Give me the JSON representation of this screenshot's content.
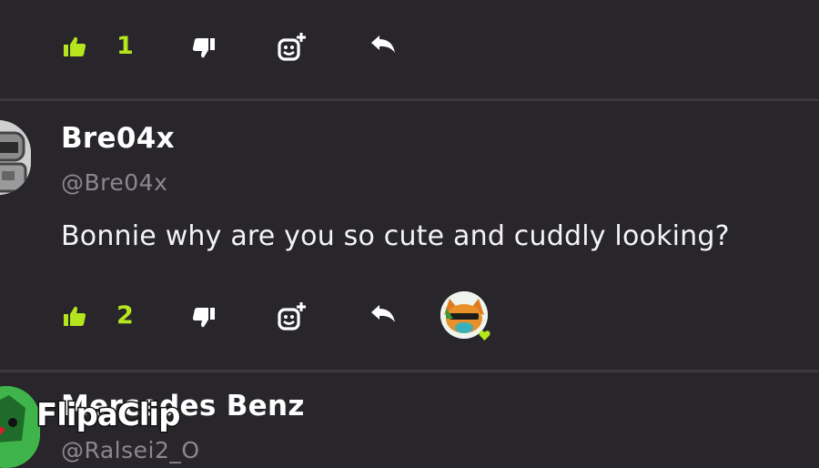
{
  "comments": [
    {
      "like_count": "1"
    },
    {
      "username": "Bre04x",
      "handle": "@Bre04x",
      "text": "Bonnie why are you so cute and cuddly looking?",
      "like_count": "2"
    },
    {
      "username": "Mercedes Benz",
      "handle": "@Ralsei2_O"
    }
  ],
  "icons": {
    "like": "thumbs-up-icon",
    "dislike": "thumbs-down-icon",
    "react": "add-reaction-icon",
    "reply": "reply-icon"
  },
  "watermark": "FlipaClip",
  "colors": {
    "background": "#28262b",
    "accent": "#b5e61d",
    "handle": "#8a8790",
    "divider": "#3b393f"
  }
}
